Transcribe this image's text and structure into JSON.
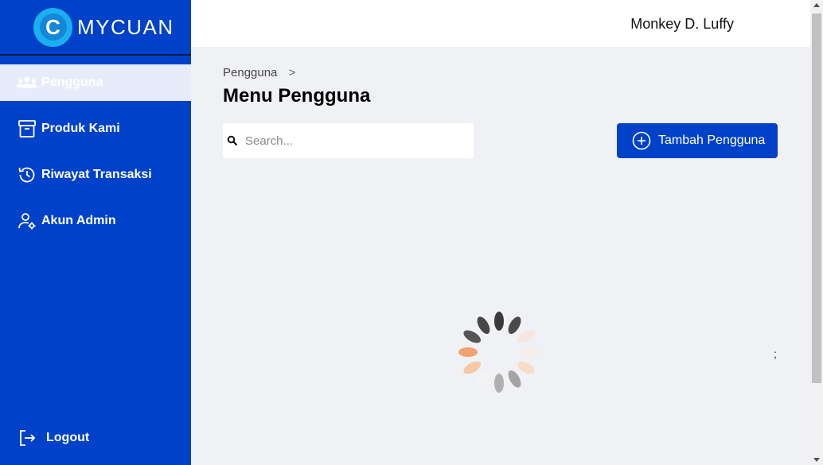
{
  "app": {
    "logo_text": "MYCUAN",
    "logo_letter": "C"
  },
  "sidebar": {
    "items": [
      {
        "label": "Pengguna",
        "icon": "users-icon",
        "active": true
      },
      {
        "label": "Produk Kami",
        "icon": "archive-box-icon"
      },
      {
        "label": "Riwayat Transaksi",
        "icon": "history-icon"
      },
      {
        "label": "Akun Admin",
        "icon": "user-cog-icon"
      }
    ],
    "logout_label": "Logout"
  },
  "header": {
    "user_name": "Monkey D. Luffy"
  },
  "main": {
    "breadcrumb": {
      "current": "Pengguna",
      "separator": ">"
    },
    "title": "Menu Pengguna",
    "search": {
      "placeholder": "Search...",
      "value": ""
    },
    "add_button_label": "Tambah Pengguna",
    "stray_text": ";"
  },
  "colors": {
    "sidebar_bg": "#0041c9",
    "accent": "#0041c9",
    "active_item_bg": "#e6ecf9",
    "logo_light": "#1ab0ef",
    "content_bg": "#f0f1f5"
  }
}
